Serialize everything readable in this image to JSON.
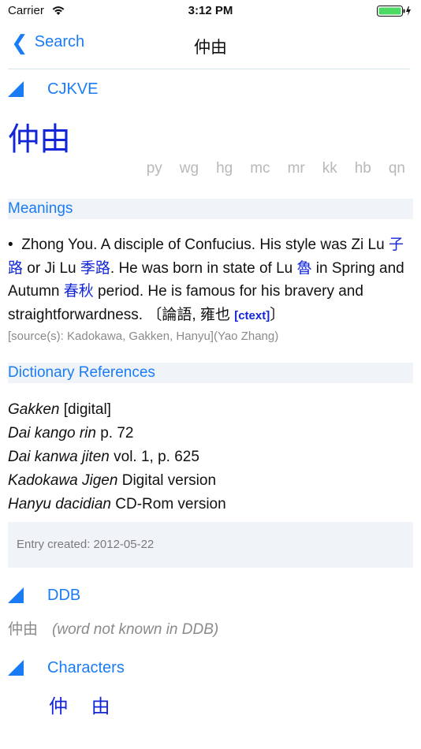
{
  "status": {
    "carrier": "Carrier",
    "time": "3:12 PM"
  },
  "nav": {
    "back_label": "Search",
    "title": "仲由"
  },
  "sections": {
    "cjkve": "CJKVE",
    "ddb": "DDB",
    "characters": "Characters"
  },
  "headword": "仲由",
  "romanization_tabs": [
    "py",
    "wg",
    "hg",
    "mc",
    "mr",
    "kk",
    "hb",
    "qn"
  ],
  "meanings": {
    "label": "Meanings",
    "bullet": "•",
    "parts": [
      "Zhong You. A disciple of Confucius. His style was Zi Lu ",
      "子路",
      " or Ji Lu ",
      "季路",
      ". He was born in state of Lu ",
      "魯",
      " in Spring and Autumn ",
      "春秋",
      " period. He is famous for his bravery and straightforwardness. 〔論語, 雍也 ",
      "[ctext]",
      "〕"
    ],
    "source": "[source(s): Kadokawa, Gakken, Hanyu](Yao Zhang)"
  },
  "dict_refs": {
    "label": "Dictionary References",
    "items": [
      {
        "title": "Gakken",
        "detail": " [digital]"
      },
      {
        "title": "Dai kango rin",
        "detail": " p. 72"
      },
      {
        "title": "Dai kanwa jiten",
        "detail": " vol. 1, p. 625"
      },
      {
        "title": "Kadokawa Jigen",
        "detail": " Digital version"
      },
      {
        "title": "Hanyu dacidian",
        "detail": " CD-Rom version"
      }
    ]
  },
  "entry_created": "Entry created: 2012-05-22",
  "ddb": {
    "word": "仲由",
    "note": "(word not known in DDB)"
  },
  "characters": [
    "仲",
    "由"
  ],
  "colors": {
    "accent": "#1a7cf5",
    "cjk_link": "#1226d8",
    "band_bg": "#f0f4f8",
    "battery": "#4cd964"
  }
}
